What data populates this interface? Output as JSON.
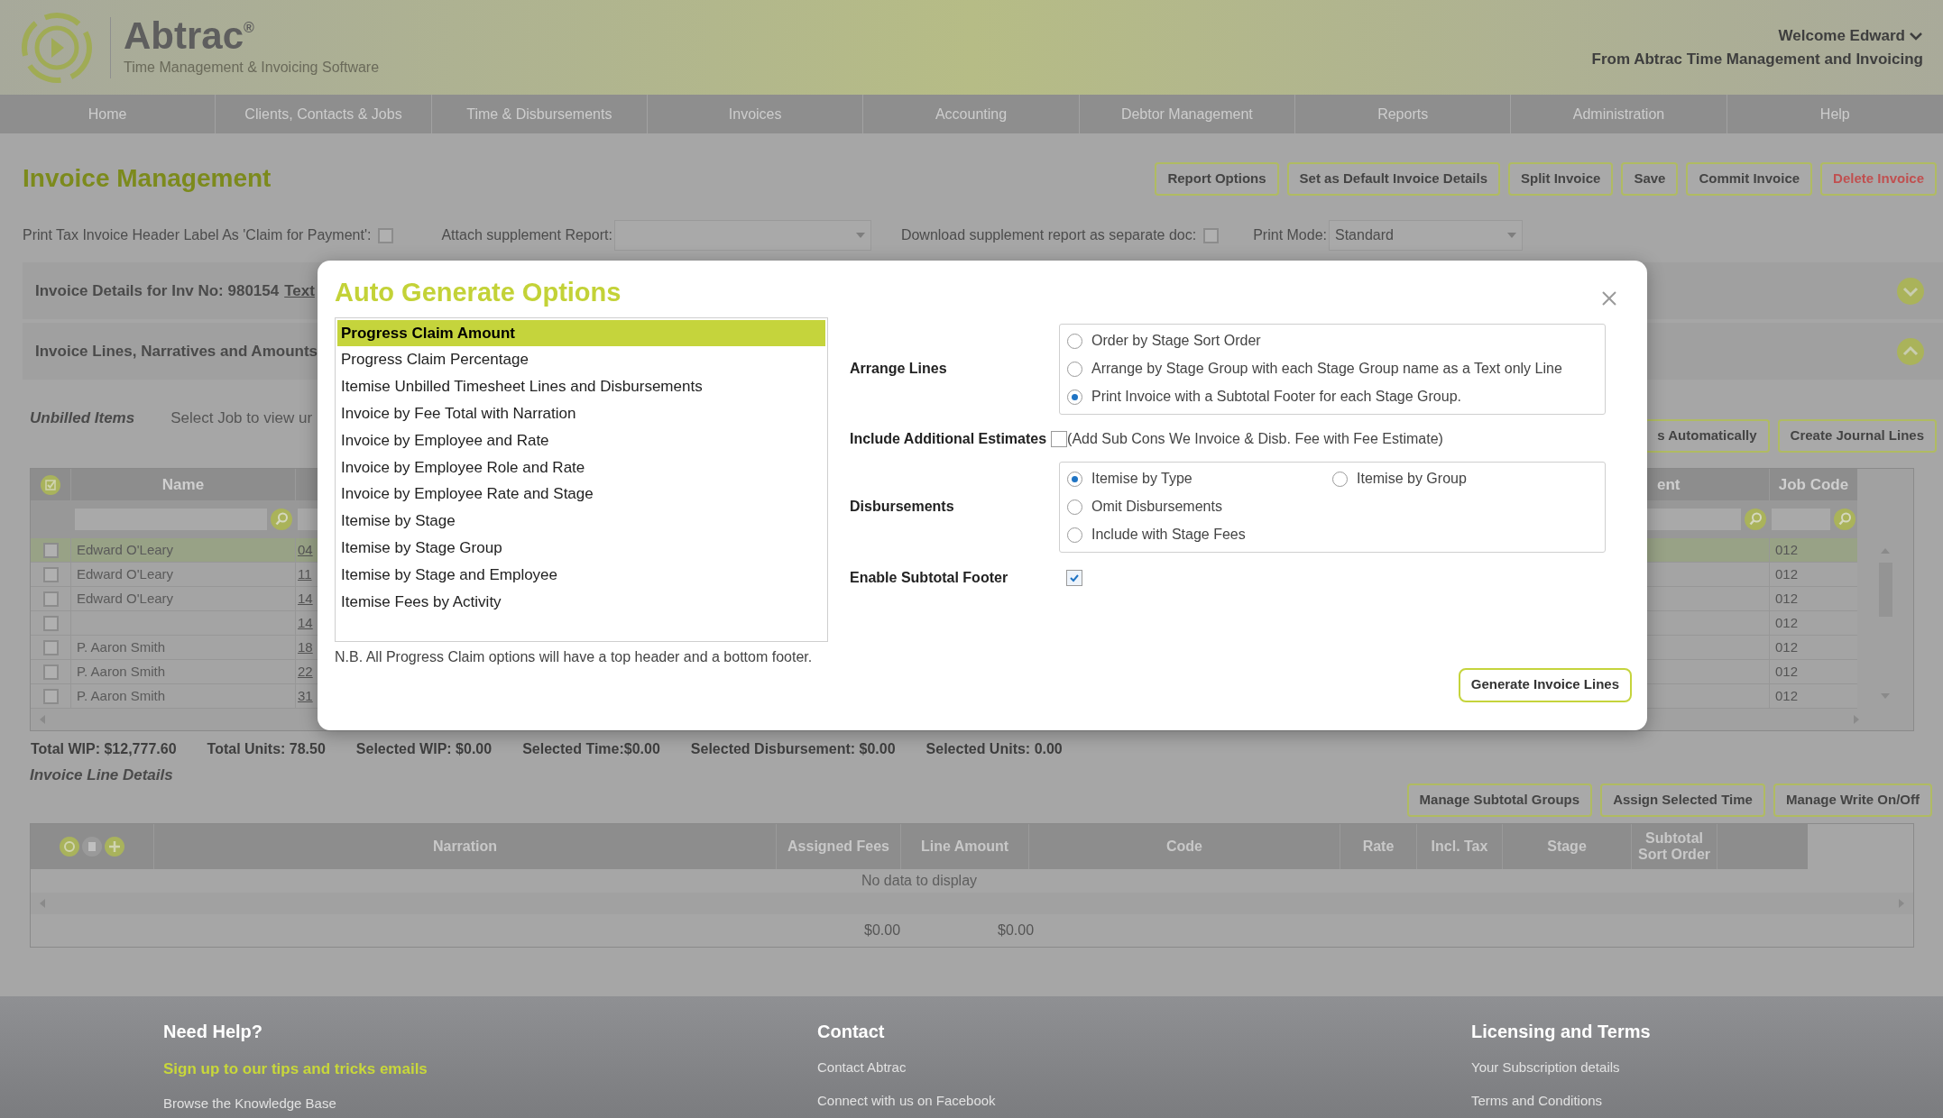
{
  "header": {
    "logo_text": "Abtrac",
    "logo_mark": "®",
    "tagline": "Time Management & Invoicing Software",
    "welcome": "Welcome Edward",
    "from": "From Abtrac Time Management and Invoicing"
  },
  "nav": [
    {
      "label": "Home"
    },
    {
      "label": "Clients, Contacts & Jobs"
    },
    {
      "label": "Time & Disbursements"
    },
    {
      "label": "Invoices"
    },
    {
      "label": "Accounting"
    },
    {
      "label": "Debtor Management"
    },
    {
      "label": "Reports"
    },
    {
      "label": "Administration"
    },
    {
      "label": "Help"
    }
  ],
  "page_title": "Invoice Management",
  "actions": [
    {
      "label": "Report Options",
      "kind": "normal"
    },
    {
      "label": "Set as Default Invoice Details",
      "kind": "normal"
    },
    {
      "label": "Split Invoice",
      "kind": "normal"
    },
    {
      "label": "Save",
      "kind": "normal"
    },
    {
      "label": "Commit Invoice",
      "kind": "normal"
    },
    {
      "label": "Delete Invoice",
      "kind": "danger"
    }
  ],
  "options": {
    "tax_label": {
      "label": "Print Tax Invoice Header Label As 'Claim for Payment':",
      "checked": false
    },
    "attach_label": "Attach supplement Report:",
    "download": {
      "label": "Download supplement report as separate doc:",
      "checked": false
    },
    "print_mode": {
      "label": "Print Mode:",
      "value": "Standard"
    }
  },
  "panels": [
    {
      "title": "Invoice Details for Inv No: 980154",
      "link": "Text",
      "expanded": false
    },
    {
      "title": "Invoice Lines, Narratives and Amounts",
      "expanded": true
    }
  ],
  "unbilled": {
    "title": "Unbilled Items",
    "hint": "Select Job to view ur",
    "buttons": [
      "s Automatically",
      "Create Journal Lines"
    ]
  },
  "unbilled_table": {
    "columns": [
      "Name",
      "ent",
      "Job Code"
    ],
    "rows": [
      {
        "name": "Edward O'Leary",
        "column_3": "04",
        "job_code": "012",
        "selected": true,
        "checked": false
      },
      {
        "name": "Edward O'Leary",
        "column_3": "11",
        "job_code": "012",
        "selected": false,
        "checked": false
      },
      {
        "name": "Edward O'Leary",
        "column_3": "14",
        "job_code": "012",
        "selected": false,
        "checked": false
      },
      {
        "column_3": "14",
        "job_code": "012",
        "selected": false,
        "checked": false
      },
      {
        "name": "P. Aaron Smith",
        "column_3": "18",
        "job_code": "012",
        "selected": false,
        "checked": false
      },
      {
        "name": "P. Aaron Smith",
        "column_3": "22",
        "job_code": "012",
        "selected": false,
        "checked": false
      },
      {
        "name": "P. Aaron Smith",
        "column_3": "31",
        "job_code": "012",
        "selected": false,
        "checked": false
      }
    ],
    "totals": [
      "Total WIP: $12,777.60",
      "Total Units: 78.50",
      "Selected WIP: $0.00",
      "Selected Time:$0.00",
      "Selected Disbursement: $0.00",
      "Selected Units: 0.00"
    ]
  },
  "line_details": {
    "title": "Invoice Line Details",
    "buttons": [
      "Manage Subtotal Groups",
      "Assign Selected Time",
      "Manage Write On/Off"
    ],
    "columns": [
      "Narration",
      "Assigned Fees",
      "Line Amount",
      "Code",
      "Rate",
      "Incl. Tax",
      "Stage",
      "Subtotal Sort Order"
    ],
    "empty": "No data to display",
    "totals": [
      "$0.00",
      "$0.00"
    ]
  },
  "footer": [
    {
      "heading": "Need Help?",
      "links": [
        {
          "label": "Sign up to our tips and tricks emails",
          "kind": "highlight"
        },
        {
          "label": "Browse the Knowledge Base",
          "kind": "plain"
        }
      ]
    },
    {
      "heading": "Contact",
      "links": [
        {
          "label": "Contact Abtrac",
          "kind": "plain"
        },
        {
          "label": "Connect with us on Facebook",
          "kind": "plain"
        }
      ]
    },
    {
      "heading": "Licensing and Terms",
      "links": [
        {
          "label": "Your Subscription details",
          "kind": "plain"
        },
        {
          "label": "Terms and Conditions",
          "kind": "plain"
        }
      ]
    }
  ],
  "dialog": {
    "title": "Auto Generate Options",
    "methods": [
      {
        "label": "Progress Claim Amount",
        "selected": true
      },
      {
        "label": "Progress Claim Percentage",
        "selected": false
      },
      {
        "label": "Itemise Unbilled Timesheet Lines and Disbursements",
        "selected": false
      },
      {
        "label": "Invoice by Fee Total with Narration",
        "selected": false
      },
      {
        "label": "Invoice by Employee and Rate",
        "selected": false
      },
      {
        "label": "Invoice by Employee Role and Rate",
        "selected": false
      },
      {
        "label": "Invoice by Employee Rate and Stage",
        "selected": false
      },
      {
        "label": "Itemise by Stage",
        "selected": false
      },
      {
        "label": "Itemise by Stage Group",
        "selected": false
      },
      {
        "label": "Itemise by Stage and Employee",
        "selected": false
      },
      {
        "label": "Itemise Fees by Activity",
        "selected": false
      }
    ],
    "note": "N.B. All Progress Claim options will have a top header and a bottom footer.",
    "arrange": {
      "label": "Arrange Lines",
      "options": [
        {
          "label": "Order by Stage Sort Order",
          "selected": false
        },
        {
          "label": "Arrange by Stage Group with each Stage Group name as a Text only Line",
          "selected": false
        },
        {
          "label": "Print Invoice with a Subtotal Footer for each Stage Group.",
          "selected": true
        }
      ]
    },
    "estimates": {
      "label": "Include Additional Estimates",
      "checked": false,
      "text": "(Add Sub Cons We Invoice & Disb. Fee with Fee Estimate)"
    },
    "disbursements": {
      "label": "Disbursements",
      "options": [
        {
          "label": "Itemise by Type",
          "selected": true
        },
        {
          "label": "Itemise by Group",
          "selected": false
        },
        {
          "label": "Omit Disbursements",
          "selected": false
        },
        {
          "label": "Include with Stage Fees",
          "selected": false
        }
      ]
    },
    "subtotal": {
      "label": "Enable Subtotal Footer",
      "checked": true
    },
    "generate": "Generate Invoice Lines"
  }
}
